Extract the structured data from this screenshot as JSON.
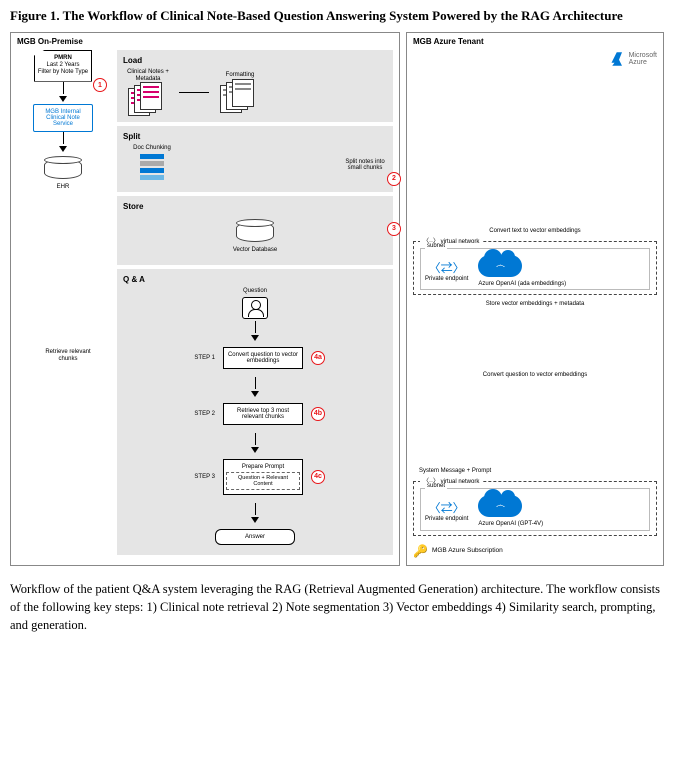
{
  "title": "Figure 1. The Workflow of Clinical Note-Based Question Answering System Powered by the RAG Architecture",
  "panels": {
    "left": "MGB On-Premise",
    "right": "MGB Azure Tenant"
  },
  "azure": {
    "brand1": "Microsoft",
    "brand2": "Azure"
  },
  "col1": {
    "pmrn_line1": "PMRN",
    "pmrn_line2": "Last 2 Years",
    "pmrn_line3": "Filter by Note Type",
    "svc": "MGB Internal Clinical Note Service",
    "ehr": "EHR"
  },
  "stages": {
    "load": "Load",
    "load_sub": "Clinical Notes + Metadata",
    "formatting": "Formatting",
    "split": "Split",
    "split_label": "Doc Chunking",
    "split_note": "Split notes into small chunks",
    "store": "Store",
    "store_db": "Vector Database",
    "qa": "Q & A",
    "qa_question": "Question",
    "qa_step1": "STEP 1",
    "qa_step1_box": "Convert question to vector embeddings",
    "qa_step2": "STEP 2",
    "qa_step2_box": "Retrieve top 3 most relevant chunks",
    "qa_step3": "STEP 3",
    "qa_step3_box": "Prepare Prompt",
    "qa_step3_sub": "Question + Relevant Content",
    "qa_answer": "Answer"
  },
  "circles": {
    "c1": "1",
    "c2": "2",
    "c3": "3",
    "c4a": "4a",
    "c4b": "4b",
    "c4c": "4c"
  },
  "conn": {
    "retrieve": "Retrieve relevant chunks",
    "convert_text": "Convert text to vector embeddings",
    "store_vec": "Store vector embeddings + metadata",
    "convert_q": "Convert question to vector embeddings",
    "sysmsg": "System Message + Prompt"
  },
  "vnet": {
    "label": "virtual network",
    "subnet": "subnet",
    "pe": "Private endpoint",
    "svc1": "Azure OpenAI (ada embeddings)",
    "svc2": "Azure OpenAI (GPT-4V)"
  },
  "footer": "MGB Azure Subscription",
  "caption": "Workflow of the patient Q&A system leveraging the RAG (Retrieval Augmented Generation) architecture. The workflow consists of the following key steps: 1) Clinical note retrieval 2) Note segmentation 3) Vector embeddings 4) Similarity search, prompting, and generation."
}
